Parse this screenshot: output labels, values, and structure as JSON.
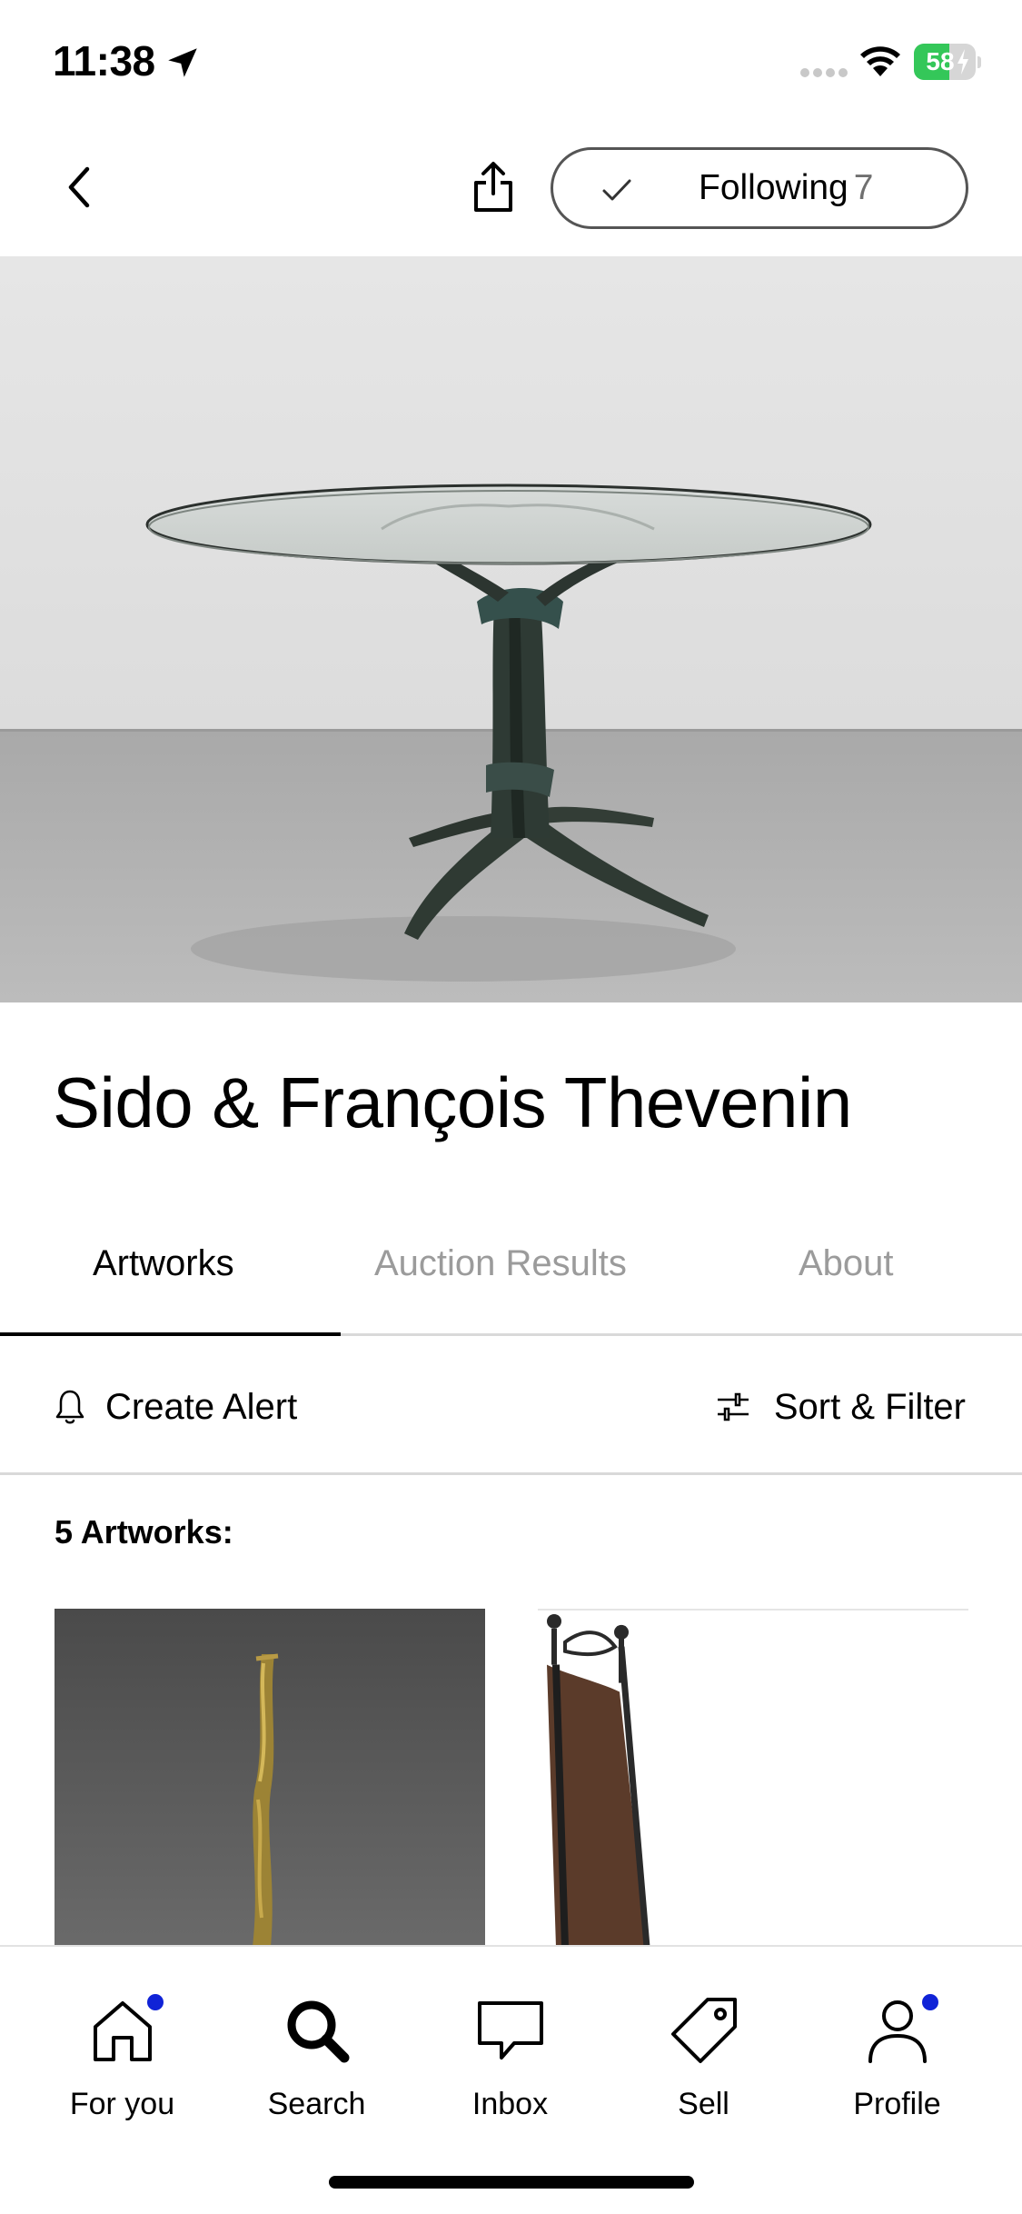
{
  "status_bar": {
    "time": "11:38",
    "battery_percent": "58",
    "battery_level": 0.58
  },
  "nav": {
    "follow_label": "Following",
    "follow_count": "7"
  },
  "artist": {
    "name": "Sido & François Thevenin"
  },
  "tabs": [
    {
      "label": "Artworks",
      "active": true
    },
    {
      "label": "Auction Results",
      "active": false
    },
    {
      "label": "About",
      "active": false
    }
  ],
  "actions": {
    "create_alert": "Create Alert",
    "sort_filter": "Sort & Filter"
  },
  "artworks": {
    "count_label": "5 Artworks:"
  },
  "tab_bar": [
    {
      "label": "For you",
      "icon": "home-icon",
      "badge": true
    },
    {
      "label": "Search",
      "icon": "search-icon",
      "badge": false
    },
    {
      "label": "Inbox",
      "icon": "inbox-icon",
      "badge": false
    },
    {
      "label": "Sell",
      "icon": "tag-icon",
      "badge": false
    },
    {
      "label": "Profile",
      "icon": "profile-icon",
      "badge": true
    }
  ],
  "colors": {
    "accent_badge": "#1023d7",
    "battery_green": "#34c759",
    "inactive_text": "#9b9b9b"
  }
}
